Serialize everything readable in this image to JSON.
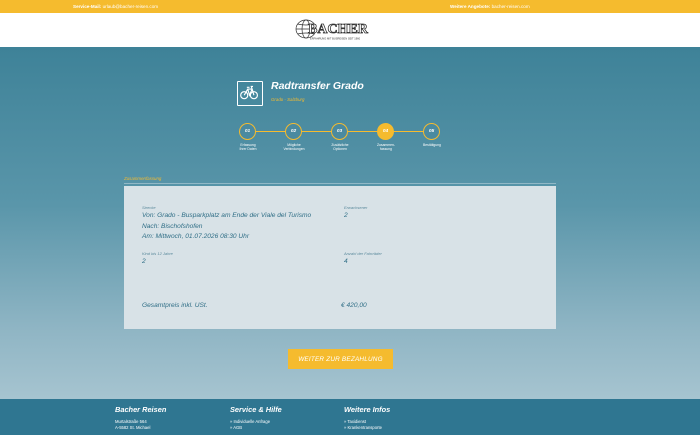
{
  "topbar": {
    "service_label": "Service-Mail:",
    "service_email": "urlaub@bacher-reisen.com",
    "more_label": "Weitere Angebote:",
    "more_link": "bacher-reisen.com"
  },
  "brand": {
    "logo_text": "BACHER",
    "logo_tagline": "ERFAHRUNG MIT BUSREISEN SEIT 1960"
  },
  "product": {
    "icon": "bicycle-icon",
    "title": "Radtransfer Grado",
    "subtitle": "Grado - Salzburg"
  },
  "steps": [
    {
      "num": "01",
      "label_line1": "Erfassung",
      "label_line2": "Ihrer Daten"
    },
    {
      "num": "02",
      "label_line1": "Mögliche",
      "label_line2": "Verbindungen"
    },
    {
      "num": "03",
      "label_line1": "Zusätzliche",
      "label_line2": "Optionen"
    },
    {
      "num": "04",
      "label_line1": "Zusammen-",
      "label_line2": "fassung"
    },
    {
      "num": "05",
      "label_line1": "Bestätigung",
      "label_line2": ""
    }
  ],
  "active_step": 4,
  "summary": {
    "section_label": "Zusammenfassung",
    "route_label": "Strecke",
    "route_from": "Von: Grado - Busparkplatz am Ende der Viale del Turismo",
    "route_to": "Nach: Bischofshofen",
    "route_date": "Am: Mittwoch, 01.07.2026 08:30 Uhr",
    "adults_label": "Erwachsener",
    "adults_value": "2",
    "children_label": "Kind bis 12 Jahre",
    "children_value": "2",
    "bikes_label": "Anzahl der Fahrräder",
    "bikes_value": "4",
    "total_label": "Gesamtpreis inkl. USt.",
    "total_value": "€ 420,00"
  },
  "cta": {
    "pay_label": "WEITER ZUR BEZAHLUNG"
  },
  "footer": {
    "col1_head": "Bacher Reisen",
    "col1_line1": "Murtalstraße 564",
    "col1_line2": "A-5582 St. Michael",
    "col2_head": "Service & Hilfe",
    "col2_line1": "» Individuelle Anfrage",
    "col2_line2": "» AGB",
    "col3_head": "Weitere Infos",
    "col3_line1": "» Taxidienst",
    "col3_line2": "» Krankentransporte"
  },
  "colors": {
    "accent": "#f5bb2e",
    "primary": "#3e8298",
    "footer": "#2f7691",
    "card": "#d8e2e7"
  }
}
